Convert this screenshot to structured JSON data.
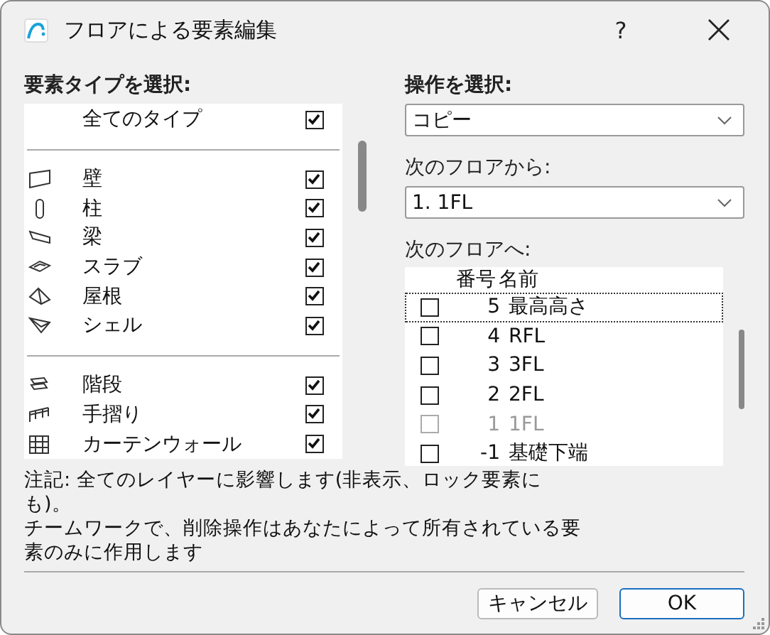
{
  "window": {
    "title": "フロアによる要素編集",
    "help": "?"
  },
  "element_types": {
    "label": "要素タイプを選択:",
    "groups": [
      [
        {
          "label": "全てのタイプ",
          "checked": true
        }
      ],
      [
        {
          "label": "壁",
          "checked": true
        },
        {
          "label": "柱",
          "checked": true
        },
        {
          "label": "梁",
          "checked": true
        },
        {
          "label": "スラブ",
          "checked": true
        },
        {
          "label": "屋根",
          "checked": true
        },
        {
          "label": "シェル",
          "checked": true
        }
      ],
      [
        {
          "label": "階段",
          "checked": true
        },
        {
          "label": "手摺り",
          "checked": true
        },
        {
          "label": "カーテンウォール",
          "checked": true
        }
      ]
    ]
  },
  "operation": {
    "label": "操作を選択:",
    "value": "コピー"
  },
  "from_floor": {
    "label": "次のフロアから:",
    "value": "1. 1FL"
  },
  "to_floor": {
    "label": "次のフロアへ:",
    "columns": [
      "番号",
      "名前"
    ],
    "rows": [
      {
        "number": "5",
        "name": "最高高さ",
        "checked": false,
        "disabled": false,
        "focused": true
      },
      {
        "number": "4",
        "name": "RFL",
        "checked": false,
        "disabled": false,
        "focused": false
      },
      {
        "number": "3",
        "name": "3FL",
        "checked": false,
        "disabled": false,
        "focused": false
      },
      {
        "number": "2",
        "name": "2FL",
        "checked": false,
        "disabled": false,
        "focused": false
      },
      {
        "number": "1",
        "name": "1FL",
        "checked": false,
        "disabled": true,
        "focused": false
      },
      {
        "number": "-1",
        "name": "基礎下端",
        "checked": false,
        "disabled": false,
        "focused": false
      }
    ]
  },
  "note": [
    "注記: 全てのレイヤーに影響します(非表示、ロック要素にも)。",
    "チームワークで、削除操作はあなたによって所有されている要素のみに作用します"
  ],
  "buttons": [
    {
      "label": "キャンセル",
      "default": false
    },
    {
      "label": "OK",
      "default": true
    }
  ]
}
